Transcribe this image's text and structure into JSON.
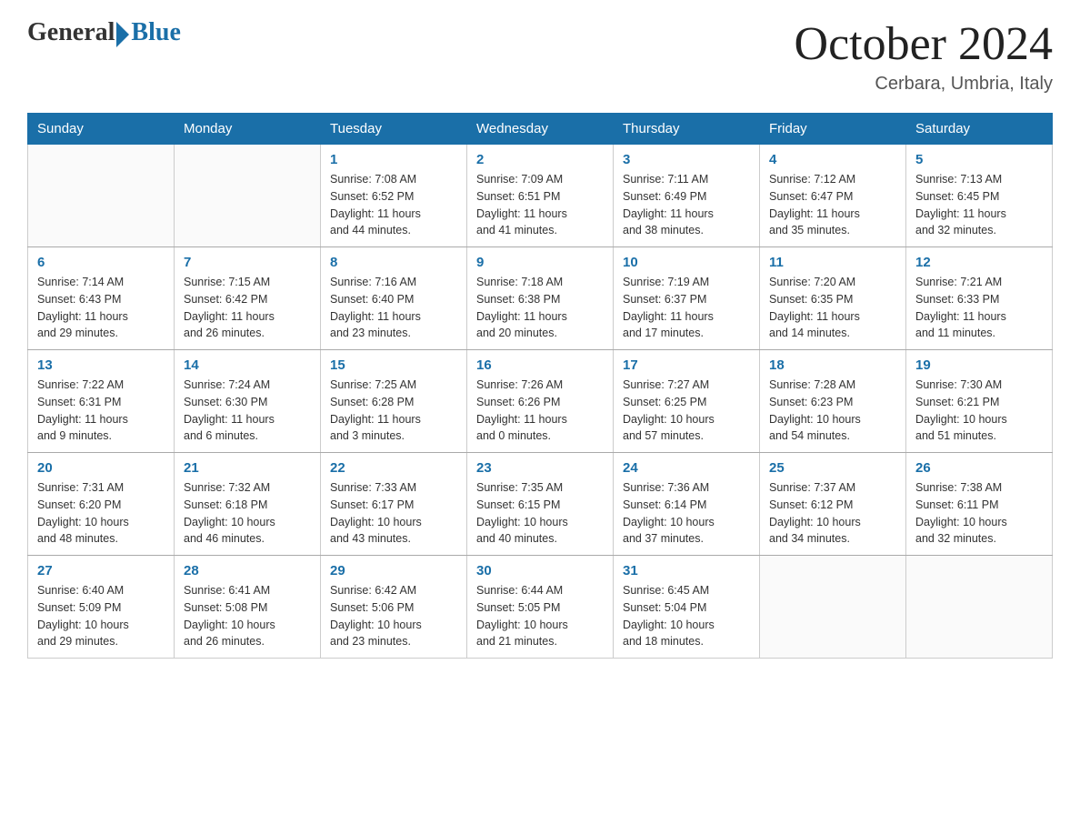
{
  "header": {
    "logo_general": "General",
    "logo_blue": "Blue",
    "month_title": "October 2024",
    "location": "Cerbara, Umbria, Italy"
  },
  "days_of_week": [
    "Sunday",
    "Monday",
    "Tuesday",
    "Wednesday",
    "Thursday",
    "Friday",
    "Saturday"
  ],
  "weeks": [
    [
      {
        "day": "",
        "info": ""
      },
      {
        "day": "",
        "info": ""
      },
      {
        "day": "1",
        "info": "Sunrise: 7:08 AM\nSunset: 6:52 PM\nDaylight: 11 hours\nand 44 minutes."
      },
      {
        "day": "2",
        "info": "Sunrise: 7:09 AM\nSunset: 6:51 PM\nDaylight: 11 hours\nand 41 minutes."
      },
      {
        "day": "3",
        "info": "Sunrise: 7:11 AM\nSunset: 6:49 PM\nDaylight: 11 hours\nand 38 minutes."
      },
      {
        "day": "4",
        "info": "Sunrise: 7:12 AM\nSunset: 6:47 PM\nDaylight: 11 hours\nand 35 minutes."
      },
      {
        "day": "5",
        "info": "Sunrise: 7:13 AM\nSunset: 6:45 PM\nDaylight: 11 hours\nand 32 minutes."
      }
    ],
    [
      {
        "day": "6",
        "info": "Sunrise: 7:14 AM\nSunset: 6:43 PM\nDaylight: 11 hours\nand 29 minutes."
      },
      {
        "day": "7",
        "info": "Sunrise: 7:15 AM\nSunset: 6:42 PM\nDaylight: 11 hours\nand 26 minutes."
      },
      {
        "day": "8",
        "info": "Sunrise: 7:16 AM\nSunset: 6:40 PM\nDaylight: 11 hours\nand 23 minutes."
      },
      {
        "day": "9",
        "info": "Sunrise: 7:18 AM\nSunset: 6:38 PM\nDaylight: 11 hours\nand 20 minutes."
      },
      {
        "day": "10",
        "info": "Sunrise: 7:19 AM\nSunset: 6:37 PM\nDaylight: 11 hours\nand 17 minutes."
      },
      {
        "day": "11",
        "info": "Sunrise: 7:20 AM\nSunset: 6:35 PM\nDaylight: 11 hours\nand 14 minutes."
      },
      {
        "day": "12",
        "info": "Sunrise: 7:21 AM\nSunset: 6:33 PM\nDaylight: 11 hours\nand 11 minutes."
      }
    ],
    [
      {
        "day": "13",
        "info": "Sunrise: 7:22 AM\nSunset: 6:31 PM\nDaylight: 11 hours\nand 9 minutes."
      },
      {
        "day": "14",
        "info": "Sunrise: 7:24 AM\nSunset: 6:30 PM\nDaylight: 11 hours\nand 6 minutes."
      },
      {
        "day": "15",
        "info": "Sunrise: 7:25 AM\nSunset: 6:28 PM\nDaylight: 11 hours\nand 3 minutes."
      },
      {
        "day": "16",
        "info": "Sunrise: 7:26 AM\nSunset: 6:26 PM\nDaylight: 11 hours\nand 0 minutes."
      },
      {
        "day": "17",
        "info": "Sunrise: 7:27 AM\nSunset: 6:25 PM\nDaylight: 10 hours\nand 57 minutes."
      },
      {
        "day": "18",
        "info": "Sunrise: 7:28 AM\nSunset: 6:23 PM\nDaylight: 10 hours\nand 54 minutes."
      },
      {
        "day": "19",
        "info": "Sunrise: 7:30 AM\nSunset: 6:21 PM\nDaylight: 10 hours\nand 51 minutes."
      }
    ],
    [
      {
        "day": "20",
        "info": "Sunrise: 7:31 AM\nSunset: 6:20 PM\nDaylight: 10 hours\nand 48 minutes."
      },
      {
        "day": "21",
        "info": "Sunrise: 7:32 AM\nSunset: 6:18 PM\nDaylight: 10 hours\nand 46 minutes."
      },
      {
        "day": "22",
        "info": "Sunrise: 7:33 AM\nSunset: 6:17 PM\nDaylight: 10 hours\nand 43 minutes."
      },
      {
        "day": "23",
        "info": "Sunrise: 7:35 AM\nSunset: 6:15 PM\nDaylight: 10 hours\nand 40 minutes."
      },
      {
        "day": "24",
        "info": "Sunrise: 7:36 AM\nSunset: 6:14 PM\nDaylight: 10 hours\nand 37 minutes."
      },
      {
        "day": "25",
        "info": "Sunrise: 7:37 AM\nSunset: 6:12 PM\nDaylight: 10 hours\nand 34 minutes."
      },
      {
        "day": "26",
        "info": "Sunrise: 7:38 AM\nSunset: 6:11 PM\nDaylight: 10 hours\nand 32 minutes."
      }
    ],
    [
      {
        "day": "27",
        "info": "Sunrise: 6:40 AM\nSunset: 5:09 PM\nDaylight: 10 hours\nand 29 minutes."
      },
      {
        "day": "28",
        "info": "Sunrise: 6:41 AM\nSunset: 5:08 PM\nDaylight: 10 hours\nand 26 minutes."
      },
      {
        "day": "29",
        "info": "Sunrise: 6:42 AM\nSunset: 5:06 PM\nDaylight: 10 hours\nand 23 minutes."
      },
      {
        "day": "30",
        "info": "Sunrise: 6:44 AM\nSunset: 5:05 PM\nDaylight: 10 hours\nand 21 minutes."
      },
      {
        "day": "31",
        "info": "Sunrise: 6:45 AM\nSunset: 5:04 PM\nDaylight: 10 hours\nand 18 minutes."
      },
      {
        "day": "",
        "info": ""
      },
      {
        "day": "",
        "info": ""
      }
    ]
  ]
}
